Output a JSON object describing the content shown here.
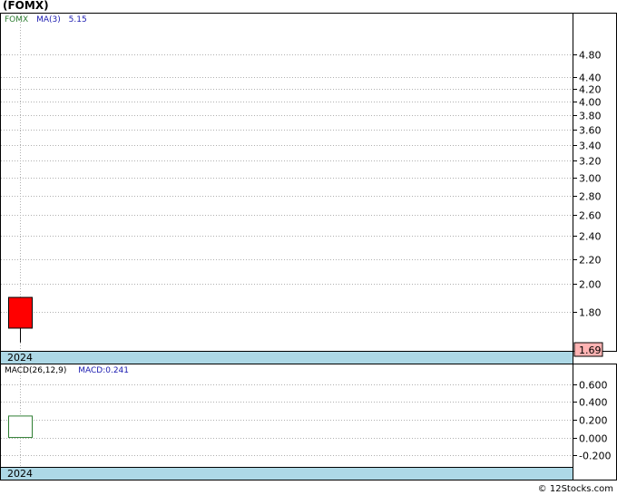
{
  "chart_data": [
    {
      "type": "candlestick",
      "title": "(FOMX)",
      "legend": [
        {
          "text": "FOMX",
          "color": "#2e7d32"
        },
        {
          "text": "MA(3)",
          "color": "#1a1ab0"
        },
        {
          "text": "5.15",
          "color": "#1a1ab0"
        }
      ],
      "y_ticks": [
        1.8,
        2.0,
        2.2,
        2.4,
        2.6,
        2.8,
        3.0,
        3.2,
        3.4,
        3.6,
        3.8,
        4.0,
        4.2,
        4.4,
        4.8
      ],
      "y_tick_labels": [
        "1.80",
        "2.00",
        "2.20",
        "2.40",
        "2.60",
        "2.80",
        "3.00",
        "3.20",
        "3.40",
        "3.60",
        "3.80",
        "4.00",
        "4.20",
        "4.40",
        "4.80"
      ],
      "y_scale": "log",
      "ylim": [
        1.55,
        5.6
      ],
      "grid": true,
      "x_label": "2024",
      "candles": [
        {
          "open": 1.9,
          "close": 1.69,
          "high": 1.9,
          "low": 1.6,
          "color": "#ff0000"
        }
      ],
      "last_value": "1.69",
      "last_value_color": "#ffb3b3"
    },
    {
      "type": "bar",
      "legend": [
        {
          "text": "MACD(26,12,9)",
          "color": "#000000"
        },
        {
          "text": "MACD:0.241",
          "color": "#1a1ab0"
        }
      ],
      "y_ticks": [
        -0.2,
        0.0,
        0.2,
        0.4,
        0.6
      ],
      "y_tick_labels": [
        "-0.200",
        "0.000",
        "0.200",
        "0.400",
        "0.600"
      ],
      "ylim": [
        -0.33,
        0.82
      ],
      "grid": true,
      "x_label": "2024",
      "bars": [
        {
          "top": 0.241,
          "bottom": 0.0,
          "stroke": "#2e7d32"
        }
      ]
    }
  ],
  "credit": "© 12Stocks.com"
}
